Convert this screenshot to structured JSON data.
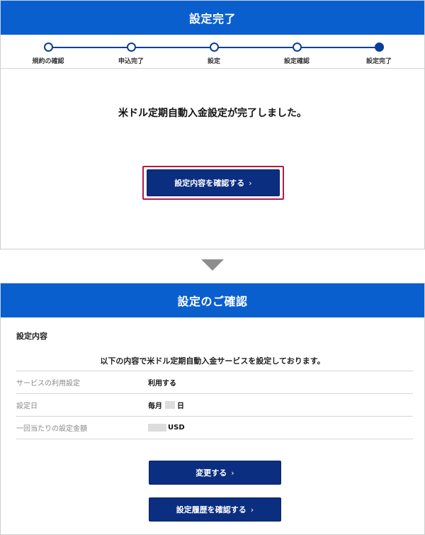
{
  "complete_panel": {
    "title": "設定完了",
    "steps": [
      {
        "label": "規約の確認",
        "active": false
      },
      {
        "label": "申込完了",
        "active": false
      },
      {
        "label": "設定",
        "active": false
      },
      {
        "label": "設定確認",
        "active": false
      },
      {
        "label": "設定完了",
        "active": true
      }
    ],
    "message": "米ドル定期自動入金設定が完了しました。",
    "confirm_button": "設定内容を確認する",
    "chevron": "›"
  },
  "confirm_panel": {
    "title": "設定のご確認",
    "section_title": "設定内容",
    "message": "以下の内容で米ドル定期自動入金サービスを設定しております。",
    "rows": [
      {
        "label": "サービスの利用設定",
        "value": "利用する"
      },
      {
        "label": "設定日",
        "value_prefix": "毎月",
        "value_suffix": "日"
      },
      {
        "label": "一回当たりの設定金額",
        "value_suffix": "USD"
      }
    ],
    "change_button": "変更する",
    "history_button": "設定履歴を確認する",
    "chevron": "›"
  },
  "colors": {
    "header_blue": "#0a5fcf",
    "button_navy": "#0c2e80",
    "focus_red": "#b3194a",
    "arrow_gray": "#8d8d8d"
  },
  "icons": {
    "down_arrow": "triangle-down-icon",
    "chevron": "chevron-right-icon"
  }
}
